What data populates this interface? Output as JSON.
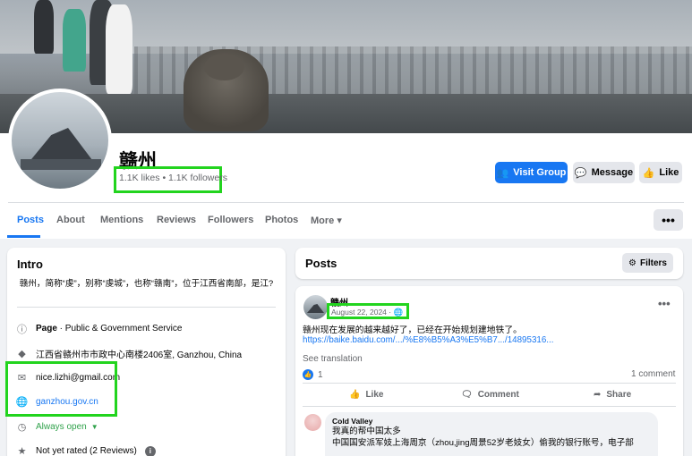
{
  "page": {
    "name": "赣州",
    "likes_followers": "1.1K likes • 1.1K followers"
  },
  "actions": {
    "visit_group": "Visit Group",
    "message": "Message",
    "like": "Like",
    "more": "•••"
  },
  "tabs": [
    {
      "label": "Posts"
    },
    {
      "label": "About"
    },
    {
      "label": "Mentions"
    },
    {
      "label": "Reviews"
    },
    {
      "label": "Followers"
    },
    {
      "label": "Photos"
    },
    {
      "label": "More ▾"
    }
  ],
  "intro": {
    "title": "Intro",
    "description": "赣州，简称“虔”，别称“虔城”，也称“赣南”，位于江西省南部，是江?",
    "page_type_bold": "Page",
    "page_type_rest": " · Public & Government Service",
    "address": "江西省赣州市市政中心南楼2406室, Ganzhou, China",
    "email": "nice.lizhi@gmail.com",
    "website": "ganzhou.gov.cn",
    "hours": "Always open",
    "rating": "Not yet rated (2 Reviews)"
  },
  "posts": {
    "title": "Posts",
    "filters": "Filters"
  },
  "post": {
    "author": "赣州",
    "date": "August 22, 2024 · ",
    "text": "赣州现在发展的越来越好了，已经在开始规划建地铁了。",
    "link": "https://baike.baidu.com/.../%E8%B5%A3%E5%B7.../14895316...",
    "see_translation": "See translation",
    "reaction_count": "1",
    "comment_count": "1 comment",
    "like_label": "Like",
    "comment_label": "Comment",
    "share_label": "Share"
  },
  "comment": {
    "author": "Cold Valley",
    "line1": "我真的帮中国太多",
    "line2": "中国国安派军妓上海周京（zhou,jing周景52岁老妓女）偷我的银行账号，电子部",
    "line3": "..."
  },
  "colors": {
    "brand": "#1877f2",
    "highlight": "#22d41e",
    "open_green": "#31a24c"
  }
}
